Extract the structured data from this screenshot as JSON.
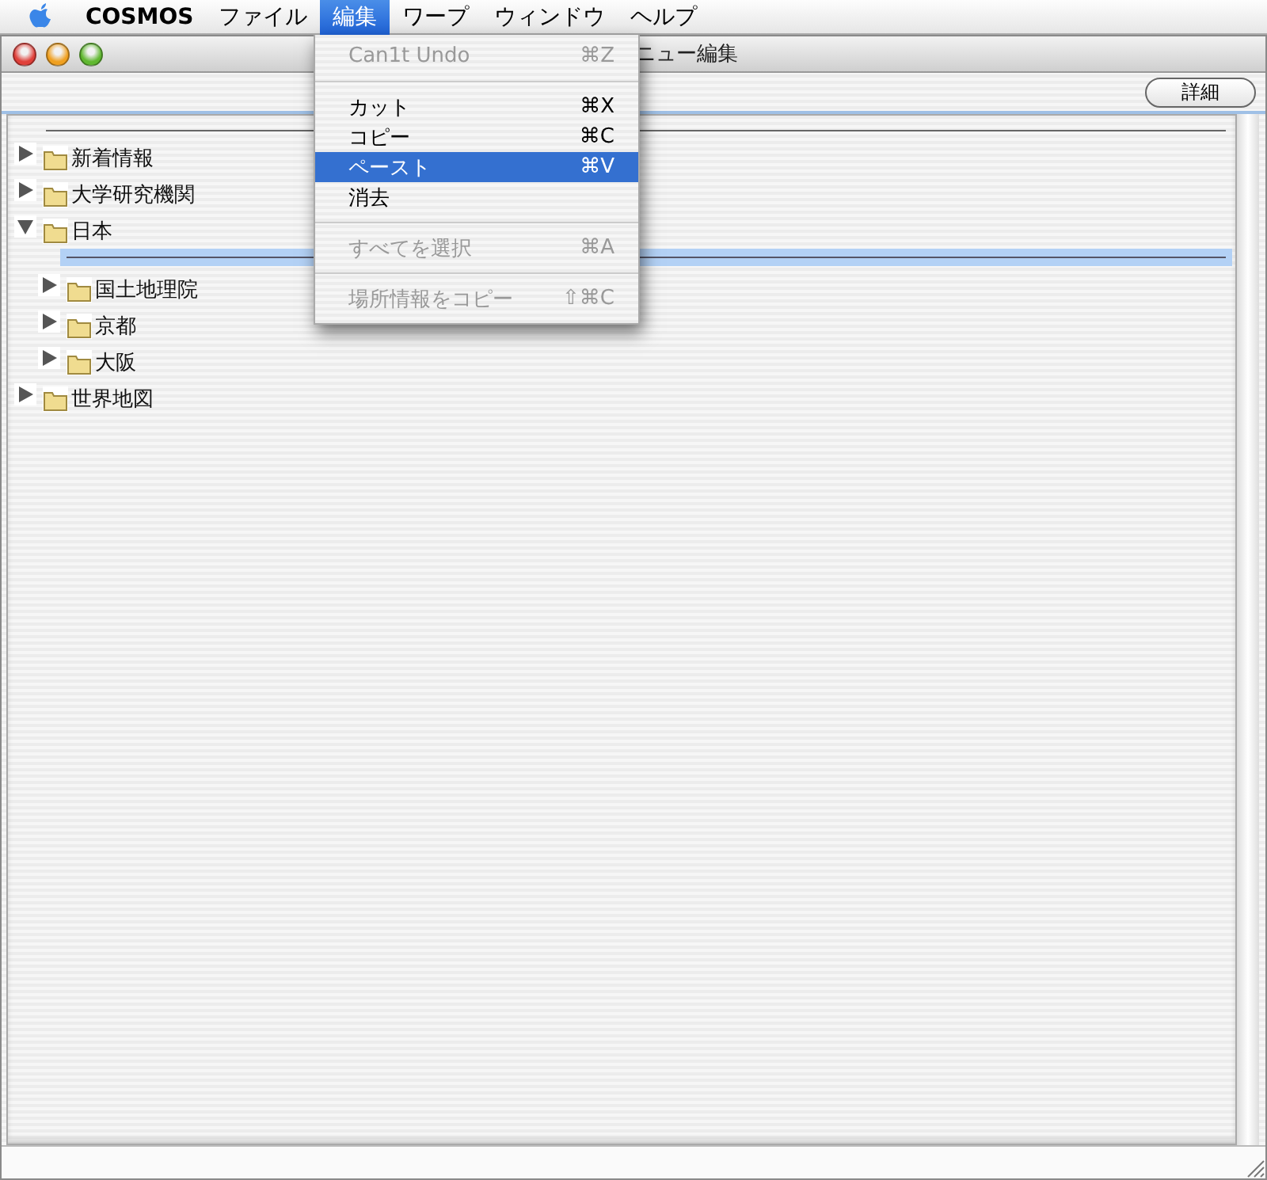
{
  "menubar": {
    "app": "COSMOS",
    "menus": [
      {
        "label": "ファイル",
        "selected": false
      },
      {
        "label": "編集",
        "selected": true
      },
      {
        "label": "ワープ",
        "selected": false
      },
      {
        "label": "ウィンドウ",
        "selected": false
      },
      {
        "label": "ヘルプ",
        "selected": false
      }
    ]
  },
  "window": {
    "title": "ニュー編集"
  },
  "toolbar": {
    "buttons": [
      "詳細"
    ]
  },
  "tree": [
    {
      "label": "新着情報",
      "expanded": false,
      "insertion_marker": false
    },
    {
      "label": "大学研究機関",
      "expanded": false,
      "insertion_marker": false
    },
    {
      "label": "日本",
      "expanded": true,
      "insertion_marker": true,
      "children": [
        {
          "label": "国土地理院",
          "expanded": false,
          "insertion_marker": false
        },
        {
          "label": "京都",
          "expanded": false,
          "insertion_marker": false
        },
        {
          "label": "大阪",
          "expanded": false,
          "insertion_marker": false
        }
      ]
    },
    {
      "label": "世界地図",
      "expanded": false,
      "insertion_marker": false
    }
  ],
  "edit_menu": [
    {
      "kind": "item",
      "label": "Can1t Undo",
      "shortcut": "⌘Z",
      "disabled": true,
      "selected": false
    },
    {
      "kind": "separator"
    },
    {
      "kind": "item",
      "label": "カット",
      "shortcut": "⌘X",
      "disabled": false,
      "selected": false
    },
    {
      "kind": "item",
      "label": "コピー",
      "shortcut": "⌘C",
      "disabled": false,
      "selected": false
    },
    {
      "kind": "item",
      "label": "ペースト",
      "shortcut": "⌘V",
      "disabled": false,
      "selected": true
    },
    {
      "kind": "item",
      "label": "消去",
      "disabled": false,
      "selected": false
    },
    {
      "kind": "separator"
    },
    {
      "kind": "item",
      "label": "すべてを選択",
      "shortcut": "⌘A",
      "disabled": true,
      "selected": false
    },
    {
      "kind": "separator"
    },
    {
      "kind": "item",
      "label": "場所情報をコピー",
      "shortcut": "⇧⌘C",
      "disabled": true,
      "selected": false
    }
  ]
}
